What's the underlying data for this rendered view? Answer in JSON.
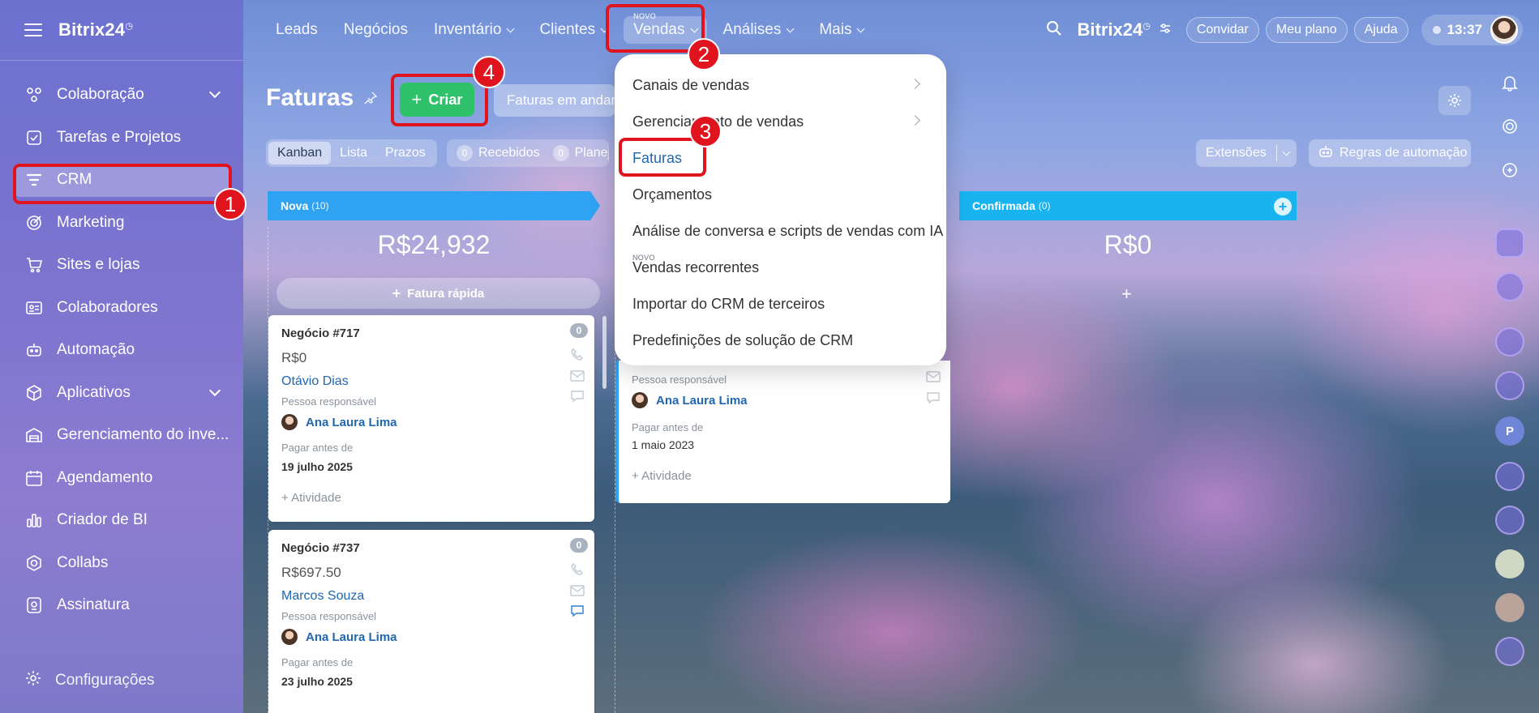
{
  "sidebar": {
    "brand": "Bitrix24",
    "items": [
      {
        "label": "Colaboração"
      },
      {
        "label": "Tarefas e Projetos"
      },
      {
        "label": "CRM"
      },
      {
        "label": "Marketing"
      },
      {
        "label": "Sites e lojas"
      },
      {
        "label": "Colaboradores"
      },
      {
        "label": "Automação"
      },
      {
        "label": "Aplicativos"
      },
      {
        "label": "Gerenciamento do inve..."
      },
      {
        "label": "Agendamento"
      },
      {
        "label": "Criador de BI"
      },
      {
        "label": "Collabs"
      },
      {
        "label": "Assinatura"
      }
    ],
    "settings": "Configurações"
  },
  "topnav": {
    "items": [
      "Leads",
      "Negócios",
      "Inventário",
      "Clientes",
      "Vendas",
      "Análises",
      "Mais"
    ],
    "novo_badge": "NOVO",
    "brand": "Bitrix24",
    "invite": "Convidar",
    "plan": "Meu plano",
    "help": "Ajuda",
    "time": "13:37"
  },
  "page": {
    "title": "Faturas",
    "create": "Criar",
    "filter": "Faturas em andamento",
    "views": [
      "Kanban",
      "Lista",
      "Prazos"
    ],
    "counters": [
      {
        "n": "0",
        "label": "Recebidos"
      },
      {
        "n": "0",
        "label": "Planejados"
      }
    ],
    "extensions": "Extensões",
    "automation": "Regras de automação"
  },
  "kanban": {
    "col1": {
      "title": "Nova",
      "count": "(10)",
      "sum": "R$24,932",
      "quick": "Fatura rápida"
    },
    "col3": {
      "title": "Confirmada",
      "count": "(0)",
      "sum": "R$0"
    },
    "cards": [
      {
        "title": "Negócio #717",
        "count": "0",
        "amount": "R$0",
        "client": "Otávio Dias",
        "resp_label": "Pessoa responsável",
        "user": "Ana Laura Lima",
        "due_label": "Pagar antes de",
        "due": "19 julho 2025",
        "activity": "+ Atividade"
      },
      {
        "title": "Negócio #737",
        "count": "0",
        "amount": "R$697.50",
        "client": "Marcos Souza",
        "resp_label": "Pessoa responsável",
        "user": "Ana Laura Lima",
        "due_label": "Pagar antes de",
        "due": "23 julho 2025"
      }
    ],
    "partial_card": {
      "resp_label": "Pessoa responsável",
      "user": "Ana Laura Lima",
      "due_label": "Pagar antes de",
      "due": "1 maio 2023",
      "activity": "+ Atividade"
    }
  },
  "dropdown": {
    "items": [
      {
        "label": "Canais de vendas"
      },
      {
        "label": "Gerenciamento de vendas"
      },
      {
        "label": "Faturas"
      },
      {
        "label": "Orçamentos"
      },
      {
        "label": "Análise de conversa e scripts de vendas com IA"
      },
      {
        "label": "Vendas recorrentes"
      },
      {
        "label": "Importar do CRM de terceiros"
      },
      {
        "label": "Predefinições de solução de CRM"
      }
    ],
    "novo_badge": "NOVO"
  },
  "annotations": [
    "1",
    "2",
    "3",
    "4"
  ],
  "rail": {
    "p_label": "P"
  },
  "colors": {
    "accent_green": "#2fc26b",
    "annotation_red": "#e0141e",
    "column_blue": "#2fa3f1",
    "link_blue": "#2067b0"
  }
}
